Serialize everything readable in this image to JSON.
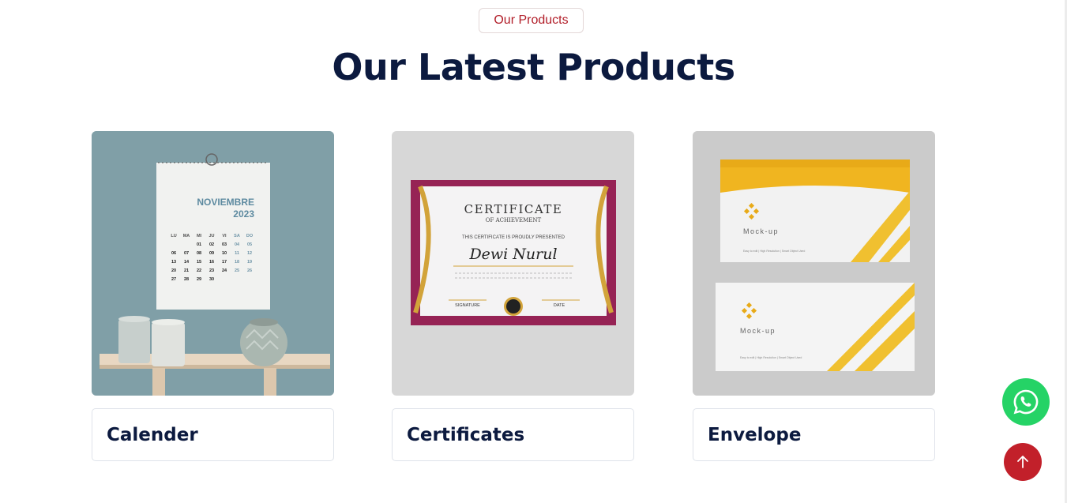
{
  "section": {
    "badge": "Our Products",
    "title": "Our Latest Products"
  },
  "products": [
    {
      "name": "Calender",
      "image": {
        "month": "NOVIEMBRE",
        "year": "2023",
        "weekdays": [
          "LU",
          "MA",
          "MI",
          "JU",
          "VI",
          "SA",
          "DO"
        ],
        "rows": [
          [
            "",
            "",
            "01",
            "02",
            "03",
            "04",
            "05"
          ],
          [
            "06",
            "07",
            "08",
            "09",
            "10",
            "11",
            "12"
          ],
          [
            "13",
            "14",
            "15",
            "16",
            "17",
            "18",
            "19"
          ],
          [
            "20",
            "21",
            "22",
            "23",
            "24",
            "25",
            "26"
          ],
          [
            "27",
            "28",
            "29",
            "30",
            "",
            "",
            ""
          ]
        ]
      }
    },
    {
      "name": "Certificates",
      "image": {
        "heading": "CERTIFICATE",
        "subheading": "OF ACHIEVEMENT",
        "presented": "THIS CERTIFICATE IS PROUDLY PRESENTED",
        "recipient": "Dewi Nurul",
        "signature_label": "SIGNATURE",
        "date_label": "DATE"
      }
    },
    {
      "name": "Envelope",
      "image": {
        "brand": "Mock-up",
        "footer": "Easy to edit | High Resolution | Smart Object Used"
      }
    }
  ],
  "floating": {
    "whatsapp_icon": "whatsapp-icon",
    "scroll_top_icon": "arrow-up-icon"
  },
  "colors": {
    "accent": "#b21f2a",
    "heading": "#0c1a3f",
    "whatsapp": "#25d366",
    "scroll_top": "#c2202a"
  }
}
